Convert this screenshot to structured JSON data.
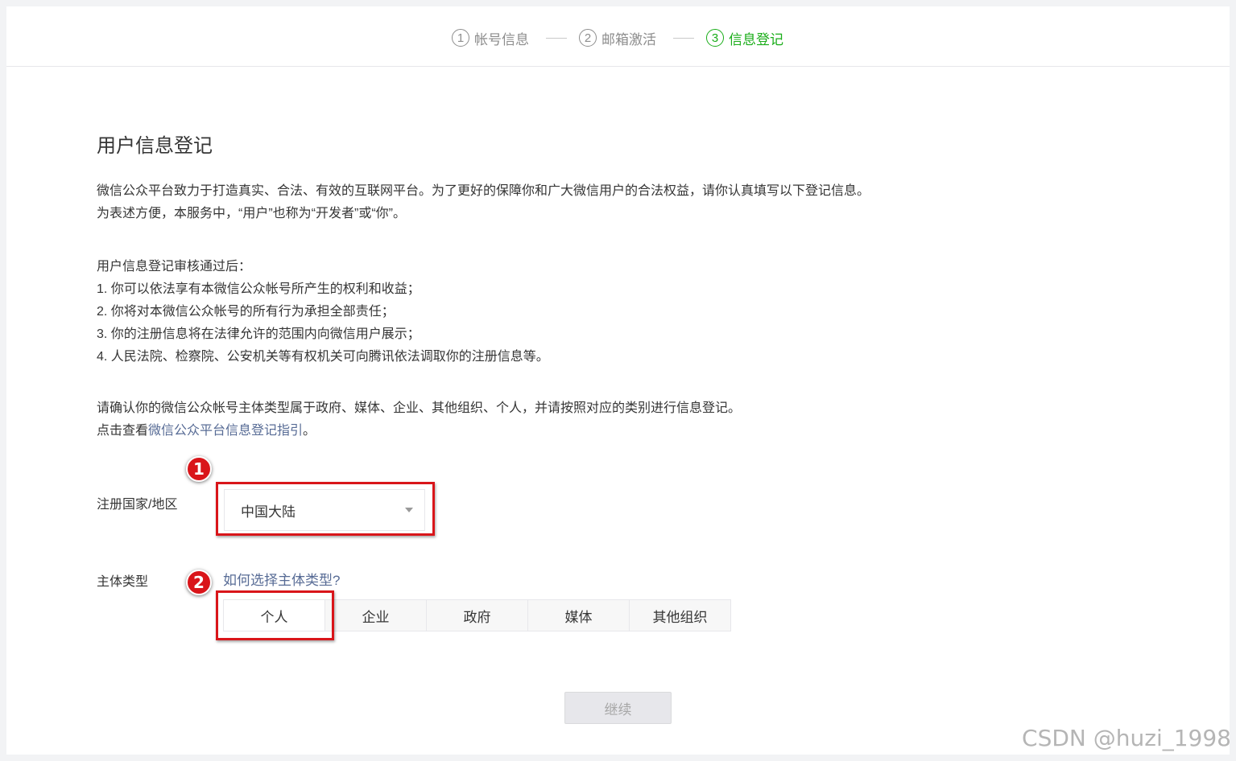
{
  "steps": [
    {
      "num": "1",
      "label": "帐号信息"
    },
    {
      "num": "2",
      "label": "邮箱激活"
    },
    {
      "num": "3",
      "label": "信息登记"
    }
  ],
  "page_title": "用户信息登记",
  "intro": [
    "微信公众平台致力于打造真实、合法、有效的互联网平台。为了更好的保障你和广大微信用户的合法权益，请你认真填写以下登记信息。",
    "为表述方便，本服务中，“用户”也称为“开发者”或“你”。"
  ],
  "after_review": [
    "用户信息登记审核通过后：",
    "1. 你可以依法享有本微信公众帐号所产生的权利和收益；",
    "2. 你将对本微信公众帐号的所有行为承担全部责任；",
    "3. 你的注册信息将在法律允许的范围内向微信用户展示；",
    "4. 人民法院、检察院、公安机关等有权机关可向腾讯依法调取你的注册信息等。"
  ],
  "confirm_text": "请确认你的微信公众帐号主体类型属于政府、媒体、企业、其他组织、个人，并请按照对应的类别进行信息登记。",
  "guide": {
    "prefix": "点击查看",
    "link": "微信公众平台信息登记指引",
    "suffix": "。"
  },
  "country": {
    "label": "注册国家/地区",
    "value": "中国大陆"
  },
  "subject": {
    "label": "主体类型",
    "help_link": "如何选择主体类型?",
    "options": [
      "个人",
      "企业",
      "政府",
      "媒体",
      "其他组织"
    ],
    "selected": "个人"
  },
  "continue_label": "继续",
  "annotations": [
    "1",
    "2"
  ],
  "colors": {
    "accent_green": "#1aad19",
    "link_blue": "#576b95",
    "annotation_red": "#d9151a"
  },
  "watermark": "CSDN @huzi_1998"
}
